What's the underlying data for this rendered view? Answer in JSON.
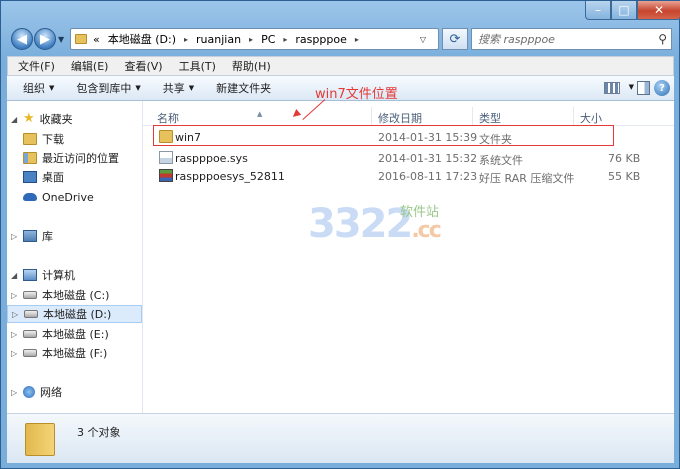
{
  "window": {
    "controls": {
      "minimize": "–",
      "maximize": "□",
      "close": "✕"
    }
  },
  "nav": {
    "back_icon": "back-arrow",
    "forward_icon": "forward-arrow"
  },
  "address": {
    "overflow": "«",
    "crumbs": [
      "本地磁盘 (D:)",
      "ruanjian",
      "PC",
      "raspppoe"
    ],
    "separator": "▸"
  },
  "search": {
    "placeholder": "搜索 raspppoe"
  },
  "menu": {
    "items": [
      "文件(F)",
      "编辑(E)",
      "查看(V)",
      "工具(T)",
      "帮助(H)"
    ]
  },
  "toolbar": {
    "organize": "组织",
    "include_in_library": "包含到库中",
    "share": "共享",
    "new_folder": "新建文件夹"
  },
  "sidebar": {
    "favorites": "收藏夹",
    "downloads": "下载",
    "recent": "最近访问的位置",
    "desktop": "桌面",
    "onedrive": "OneDrive",
    "libraries": "库",
    "computer": "计算机",
    "drive_c": "本地磁盘 (C:)",
    "drive_d": "本地磁盘 (D:)",
    "drive_e": "本地磁盘 (E:)",
    "drive_f": "本地磁盘 (F:)",
    "network": "网络"
  },
  "columns": {
    "name": "名称",
    "modified": "修改日期",
    "type": "类型",
    "size": "大小"
  },
  "files": [
    {
      "name": "win7",
      "modified": "2014-01-31 15:39",
      "type": "文件夹",
      "size": "",
      "icon": "folder-icon"
    },
    {
      "name": "raspppoe.sys",
      "modified": "2014-01-31 15:32",
      "type": "系统文件",
      "size": "76 KB",
      "icon": "sys-file-icon"
    },
    {
      "name": "raspppoesys_52811",
      "modified": "2016-08-11 17:23",
      "type": "好压 RAR 压缩文件",
      "size": "55 KB",
      "icon": "rar-archive-icon"
    }
  ],
  "annotation": {
    "text": "win7文件位置",
    "color": "#e53935"
  },
  "watermark": {
    "main": "3322",
    "suffix": ".cc",
    "tag": "软件站"
  },
  "status": {
    "count": "3 个对象"
  }
}
